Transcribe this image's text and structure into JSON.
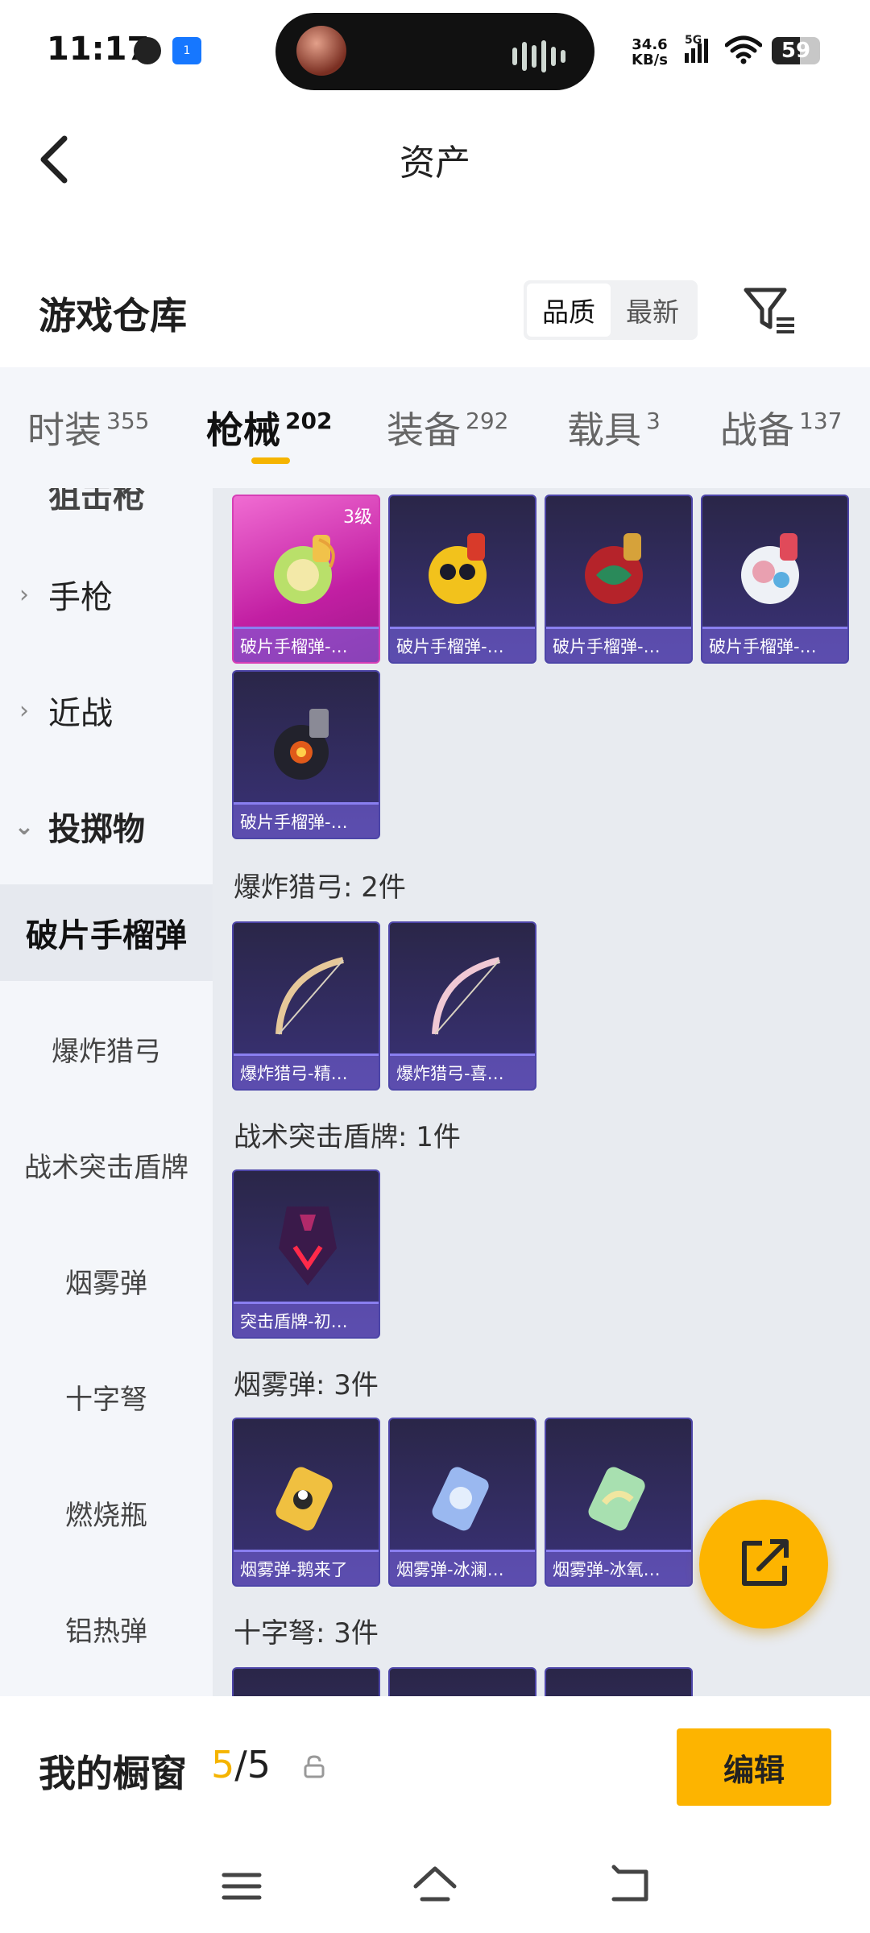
{
  "status_bar": {
    "time": "11:17",
    "notif_badge": "1",
    "net_speed_value": "34.6",
    "net_speed_unit": "KB/s",
    "network": "5G",
    "battery": "59"
  },
  "header": {
    "title": "资产"
  },
  "section": {
    "title": "游戏仓库",
    "sort_options": [
      "品质",
      "最新"
    ],
    "sort_active": "品质"
  },
  "tabs": [
    {
      "label": "时装",
      "count": "355"
    },
    {
      "label": "枪械",
      "count": "202"
    },
    {
      "label": "装备",
      "count": "292"
    },
    {
      "label": "载具",
      "count": "3"
    },
    {
      "label": "战备",
      "count": "137"
    }
  ],
  "sidebar": {
    "partial_item": "狙击枪",
    "categories": [
      {
        "label": "手枪",
        "expanded": false
      },
      {
        "label": "近战",
        "expanded": false
      },
      {
        "label": "投掷物",
        "expanded": true
      }
    ],
    "subitems": [
      "破片手榴弹",
      "爆炸猎弓",
      "战术突击盾牌",
      "烟雾弹",
      "十字弩",
      "燃烧瓶",
      "铝热弹"
    ],
    "active_subitem": "破片手榴弹"
  },
  "content": {
    "grenade_items": [
      {
        "name": "破片手榴弹-…",
        "level": "3级"
      },
      {
        "name": "破片手榴弹-…"
      },
      {
        "name": "破片手榴弹-…"
      },
      {
        "name": "破片手榴弹-…"
      },
      {
        "name": "破片手榴弹-…"
      }
    ],
    "groups": [
      {
        "title": "爆炸猎弓: 2件",
        "items": [
          "爆炸猎弓-精…",
          "爆炸猎弓-喜…"
        ]
      },
      {
        "title": "战术突击盾牌: 1件",
        "items": [
          "突击盾牌-初…"
        ]
      },
      {
        "title": "烟雾弹: 3件",
        "items": [
          "烟雾弹-鹅来了",
          "烟雾弹-冰澜…",
          "烟雾弹-冰氧…"
        ]
      },
      {
        "title": "十字弩: 3件",
        "items": []
      }
    ]
  },
  "bottom": {
    "showcase_label": "我的橱窗",
    "showcase_current": "5",
    "showcase_total": "/5",
    "edit_label": "编辑"
  },
  "colors": {
    "accent": "#fdb400",
    "card_bg": "#2a2648",
    "card_epic": "#c21fa3"
  }
}
